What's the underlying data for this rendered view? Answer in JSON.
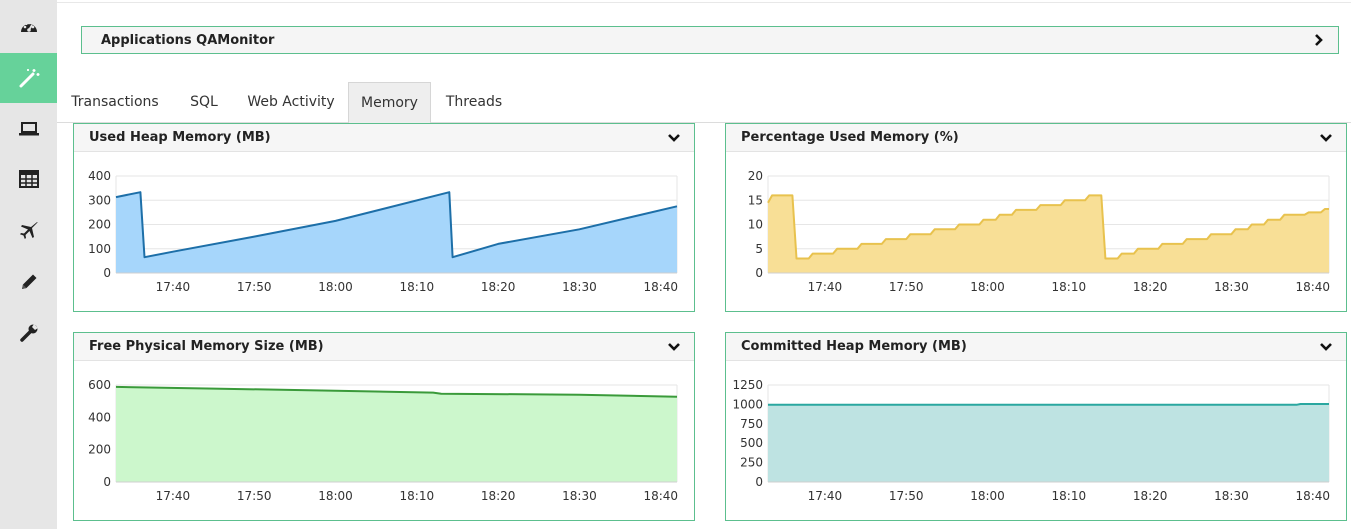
{
  "sidebar": {
    "items": [
      {
        "icon": "dashboard-icon"
      },
      {
        "icon": "magic-wand-icon",
        "active": true
      },
      {
        "icon": "laptop-icon"
      },
      {
        "icon": "table-icon"
      },
      {
        "icon": "airplane-icon"
      },
      {
        "icon": "pencil-icon"
      },
      {
        "icon": "wrench-icon"
      }
    ]
  },
  "app_header": {
    "title": "Applications QAMonitor",
    "expand_icon": "chevron-right-icon"
  },
  "tabs": [
    {
      "label": "Transactions"
    },
    {
      "label": "SQL"
    },
    {
      "label": "Web Activity"
    },
    {
      "label": "Memory",
      "active": true
    },
    {
      "label": "Threads"
    }
  ],
  "chart_data": [
    {
      "type": "area",
      "title": "Used Heap Memory (MB)",
      "color": "#1d6fa8",
      "fill": "#a6d6fb",
      "ylim": [
        0,
        400
      ],
      "yticks": [
        "0",
        "100",
        "200",
        "300",
        "400"
      ],
      "xlim": [
        "17:33",
        "18:42"
      ],
      "xticks": [
        "17:40",
        "17:50",
        "18:00",
        "18:10",
        "18:20",
        "18:30",
        "18:40"
      ],
      "x": [
        "17:33",
        "17:36",
        "17:36.5",
        "17:40",
        "17:50",
        "18:00",
        "18:14",
        "18:14.4",
        "18:20",
        "18:30",
        "18:42"
      ],
      "values": [
        313,
        333,
        65,
        88,
        150,
        215,
        333,
        65,
        120,
        180,
        275
      ]
    },
    {
      "type": "area",
      "title": "Percentage Used Memory (%)",
      "color": "#e8c24e",
      "fill": "#f8df96",
      "ylim": [
        0,
        20
      ],
      "yticks": [
        "0",
        "5",
        "10",
        "15",
        "20"
      ],
      "xlim": [
        "17:33",
        "18:42"
      ],
      "xticks": [
        "17:40",
        "17:50",
        "18:00",
        "18:10",
        "18:20",
        "18:30",
        "18:40"
      ],
      "x": [
        "17:33",
        "17:33.5",
        "17:36",
        "17:36.5",
        "17:38",
        "17:38.5",
        "17:41",
        "17:41.5",
        "17:44",
        "17:44.5",
        "17:47",
        "17:47.5",
        "17:50",
        "17:50.5",
        "17:53",
        "17:53.5",
        "17:56",
        "17:56.5",
        "17:59",
        "17:59.5",
        "18:01",
        "18:01.5",
        "18:03",
        "18:03.5",
        "18:06",
        "18:06.5",
        "18:09",
        "18:09.5",
        "18:12",
        "18:12.5",
        "18:14",
        "18:14.5",
        "18:16",
        "18:16.5",
        "18:18",
        "18:18.5",
        "18:21",
        "18:21.5",
        "18:24",
        "18:24.5",
        "18:27",
        "18:27.5",
        "18:30",
        "18:30.5",
        "18:32",
        "18:32.5",
        "18:34",
        "18:34.5",
        "18:36",
        "18:36.5",
        "18:39",
        "18:39.5",
        "18:41",
        "18:41.5",
        "18:42"
      ],
      "values": [
        14.5,
        16,
        16,
        3,
        3,
        4,
        4,
        5,
        5,
        6,
        6,
        7,
        7,
        8,
        8,
        9,
        9,
        10,
        10,
        11,
        11,
        12,
        12,
        13,
        13,
        14,
        14,
        15,
        15,
        16,
        16,
        3,
        3,
        4,
        4,
        5,
        5,
        6,
        6,
        7,
        7,
        8,
        8,
        9,
        9,
        10,
        10,
        11,
        11,
        12,
        12,
        12.5,
        12.5,
        13.2,
        13.2
      ]
    },
    {
      "type": "area",
      "title": "Free Physical Memory Size (MB)",
      "color": "#3a9a3a",
      "fill": "#ccf7cc",
      "ylim": [
        0,
        600
      ],
      "yticks": [
        "0",
        "200",
        "400",
        "600"
      ],
      "xlim": [
        "17:33",
        "18:42"
      ],
      "xticks": [
        "17:40",
        "17:50",
        "18:00",
        "18:10",
        "18:20",
        "18:30",
        "18:40"
      ],
      "x": [
        "17:33",
        "17:45",
        "18:00",
        "18:12",
        "18:13",
        "18:30",
        "18:42"
      ],
      "values": [
        588,
        578,
        565,
        553,
        546,
        540,
        527
      ]
    },
    {
      "type": "area",
      "title": "Committed Heap Memory (MB)",
      "color": "#2aa7a0",
      "fill": "#bee3e2",
      "ylim": [
        0,
        1250
      ],
      "yticks": [
        "0",
        "250",
        "500",
        "750",
        "1000",
        "1250"
      ],
      "xlim": [
        "17:33",
        "18:42"
      ],
      "xticks": [
        "17:40",
        "17:50",
        "18:00",
        "18:10",
        "18:20",
        "18:30",
        "18:40"
      ],
      "x": [
        "17:33",
        "18:38",
        "18:38.5",
        "18:42"
      ],
      "values": [
        995,
        995,
        1005,
        1005
      ]
    }
  ]
}
